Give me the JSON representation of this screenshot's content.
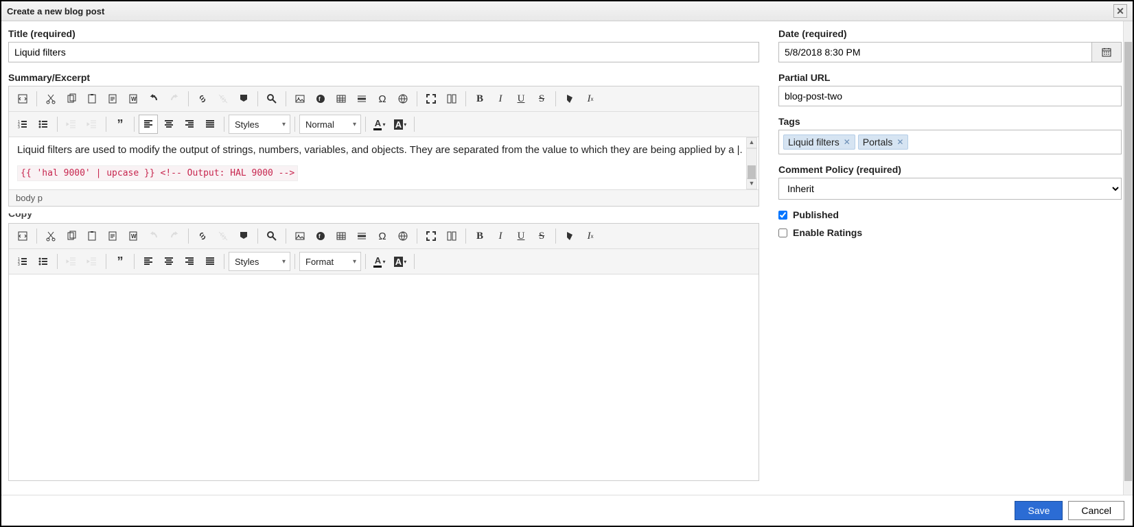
{
  "window_title": "Create a new blog post",
  "left": {
    "title_label": "Title (required)",
    "title_value": "Liquid filters",
    "summary_label": "Summary/Excerpt",
    "summary_text": "Liquid filters are used to modify the output of strings, numbers, variables, and objects. They are separated from the value to which they are being applied by a |.",
    "summary_code": "{{ 'hal 9000' | upcase }} <!-- Output: HAL 9000 -->",
    "summary_status": "body p",
    "copy_label_cut": "Copy",
    "styles_label": "Styles",
    "normal_label": "Normal",
    "format_label": "Format"
  },
  "right": {
    "date_label": "Date (required)",
    "date_value": "5/8/2018 8:30 PM",
    "url_label": "Partial URL",
    "url_value": "blog-post-two",
    "tags_label": "Tags",
    "tags": [
      "Liquid filters",
      "Portals"
    ],
    "comment_label": "Comment Policy (required)",
    "comment_value": "Inherit",
    "published_label": "Published",
    "published_checked": true,
    "ratings_label": "Enable Ratings",
    "ratings_checked": false
  },
  "footer": {
    "save": "Save",
    "cancel": "Cancel"
  }
}
